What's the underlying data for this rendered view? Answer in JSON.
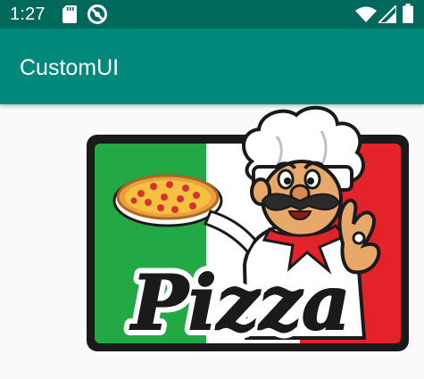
{
  "status_bar": {
    "time": "1:27",
    "icons": [
      "sd-card-icon",
      "do-not-disturb-icon",
      "wifi-icon",
      "signal-icon",
      "battery-icon"
    ],
    "background": "#00695c"
  },
  "app_bar": {
    "title": "CustomUI",
    "background": "#00897b"
  },
  "content": {
    "background": "#fafafa",
    "image": {
      "icon": "pizza-chef-logo",
      "text": "Pizza",
      "colors": {
        "green": "#22a845",
        "white": "#ffffff",
        "red": "#e42229",
        "frame": "#1a1a1a"
      }
    }
  }
}
